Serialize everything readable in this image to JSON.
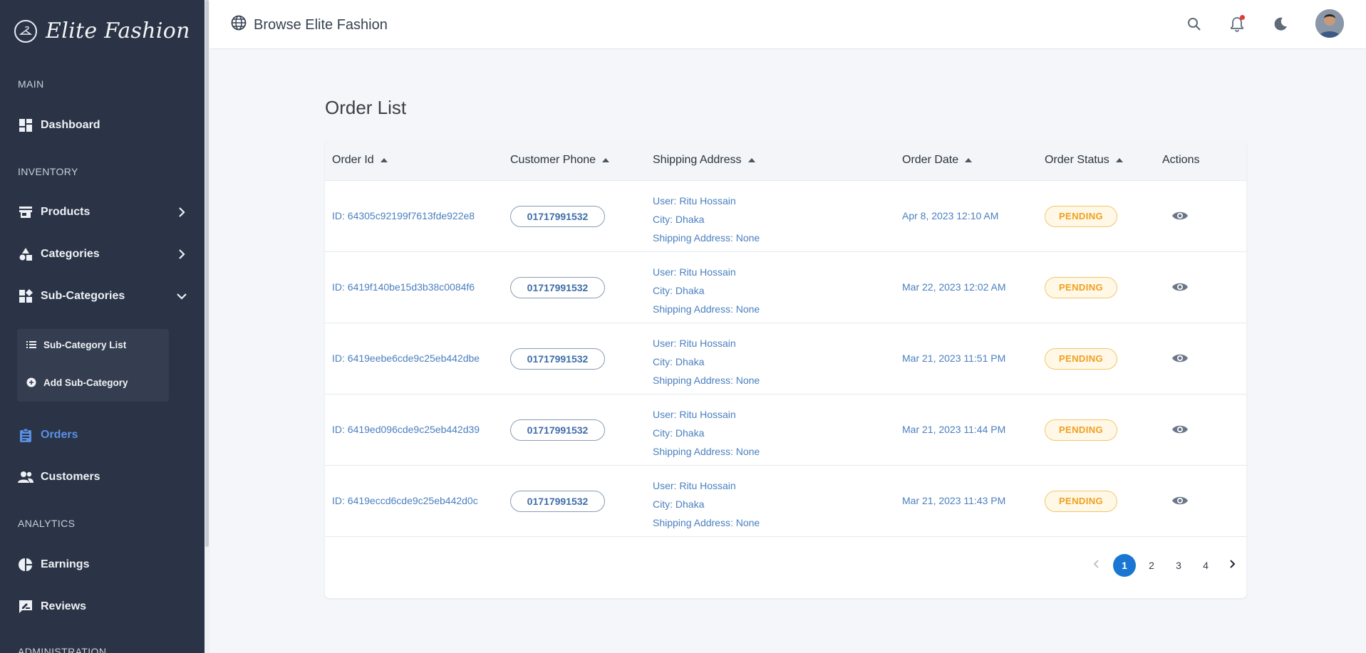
{
  "brand": {
    "name": "Elite Fashion",
    "logo_icon": "hanger-logo"
  },
  "sidebar": {
    "sections": [
      {
        "label": "MAIN"
      },
      {
        "label": "INVENTORY"
      },
      {
        "label": "ANALYTICS"
      },
      {
        "label": "ADMINISTRATION"
      }
    ],
    "items": [
      {
        "label": "Dashboard",
        "icon": "dashboard-icon"
      },
      {
        "label": "Products",
        "icon": "store-icon"
      },
      {
        "label": "Categories",
        "icon": "shapes-icon"
      },
      {
        "label": "Sub-Categories",
        "icon": "widgets-icon"
      },
      {
        "label": "Orders",
        "icon": "clipboard-icon",
        "active": true
      },
      {
        "label": "Customers",
        "icon": "people-icon"
      },
      {
        "label": "Earnings",
        "icon": "pie-chart-icon"
      },
      {
        "label": "Reviews",
        "icon": "rate-review-icon"
      }
    ],
    "submenu": [
      {
        "label": "Sub-Category List",
        "icon": "list-icon"
      },
      {
        "label": "Add Sub-Category",
        "icon": "add-circle-icon"
      }
    ],
    "active_color": "#5b8fe6"
  },
  "topbar": {
    "title": "Browse Elite Fashion",
    "icons": [
      "globe-icon",
      "search-icon",
      "bell-icon",
      "moon-icon",
      "avatar"
    ]
  },
  "main": {
    "title": "Order List",
    "columns": [
      "Order Id",
      "Customer Phone",
      "Shipping Address",
      "Order Date",
      "Order Status",
      "Actions"
    ],
    "rows": [
      {
        "id": "ID: 64305c92199f7613fde922e8",
        "phone": "01717991532",
        "user": "User: Ritu Hossain",
        "city": "City: Dhaka",
        "shipping": "Shipping Address: None",
        "date": "Apr 8, 2023 12:10 AM",
        "status": "PENDING"
      },
      {
        "id": "ID: 6419f140be15d3b38c0084f6",
        "phone": "01717991532",
        "user": "User: Ritu Hossain",
        "city": "City: Dhaka",
        "shipping": "Shipping Address: None",
        "date": "Mar 22, 2023 12:02 AM",
        "status": "PENDING"
      },
      {
        "id": "ID: 6419eebe6cde9c25eb442dbe",
        "phone": "01717991532",
        "user": "User: Ritu Hossain",
        "city": "City: Dhaka",
        "shipping": "Shipping Address: None",
        "date": "Mar 21, 2023 11:51 PM",
        "status": "PENDING"
      },
      {
        "id": "ID: 6419ed096cde9c25eb442d39",
        "phone": "01717991532",
        "user": "User: Ritu Hossain",
        "city": "City: Dhaka",
        "shipping": "Shipping Address: None",
        "date": "Mar 21, 2023 11:44 PM",
        "status": "PENDING"
      },
      {
        "id": "ID: 6419eccd6cde9c25eb442d0c",
        "phone": "01717991532",
        "user": "User: Ritu Hossain",
        "city": "City: Dhaka",
        "shipping": "Shipping Address: None",
        "date": "Mar 21, 2023 11:43 PM",
        "status": "PENDING"
      }
    ],
    "pagination": {
      "pages": [
        "1",
        "2",
        "3",
        "4"
      ],
      "current": "1",
      "accent": "#1976d2"
    },
    "status_color": "#f0a020",
    "link_color": "#4a7fbf"
  }
}
